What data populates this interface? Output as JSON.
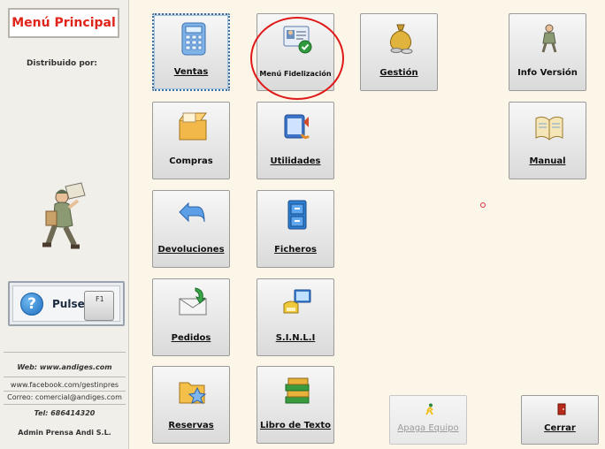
{
  "sidebar": {
    "title": "Menú Principal",
    "distribuido_label": "Distribuido por:",
    "pulse_label": "Pulse",
    "f1_key": "F1",
    "help_icon_glyph": "?",
    "web": "Web: www.andiges.com",
    "facebook": "www.facebook.com/gestinpres",
    "correo": "Correo: comercial@andiges.com",
    "tel": "Tel: 686414320",
    "company": "Admin Prensa Andi S.L."
  },
  "menu": {
    "ventas": "Ventas",
    "fidelizacion": "Menú Fidelización",
    "gestion": "Gestión",
    "info_version": "Info Versión",
    "compras": "Compras",
    "utilidades": "Utilidades",
    "manual": "Manual",
    "devoluciones": "Devoluciones",
    "ficheros": "Ficheros",
    "pedidos": "Pedidos",
    "sinli": "S.I.N.L.I",
    "reservas": "Reservas",
    "libro_texto": "Libro de Texto",
    "apaga_equipo": "Apaga Equipo",
    "cerrar": "Cerrar"
  },
  "colors": {
    "title_red": "#e0241a",
    "highlight_circle": "#e01818",
    "background": "#fbf6e8"
  }
}
